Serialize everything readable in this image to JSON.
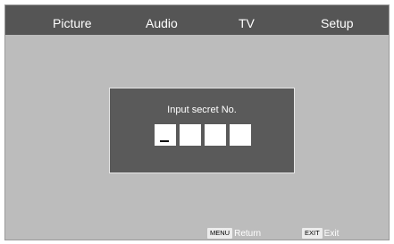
{
  "menu": {
    "items": [
      {
        "label": "Picture"
      },
      {
        "label": "Audio"
      },
      {
        "label": "TV"
      },
      {
        "label": "Setup"
      }
    ]
  },
  "dialog": {
    "title": "Input secret No.",
    "pin_digits": [
      "",
      "",
      "",
      ""
    ],
    "cursor_glyph": "_"
  },
  "footer": {
    "return_key": "MENU",
    "return_label": "Return",
    "exit_key": "EXIT",
    "exit_label": "Exit"
  },
  "colors": {
    "background": "#bcbcbc",
    "menubar": "#555555",
    "dialog": "#5a5a5a",
    "text": "#ffffff"
  }
}
